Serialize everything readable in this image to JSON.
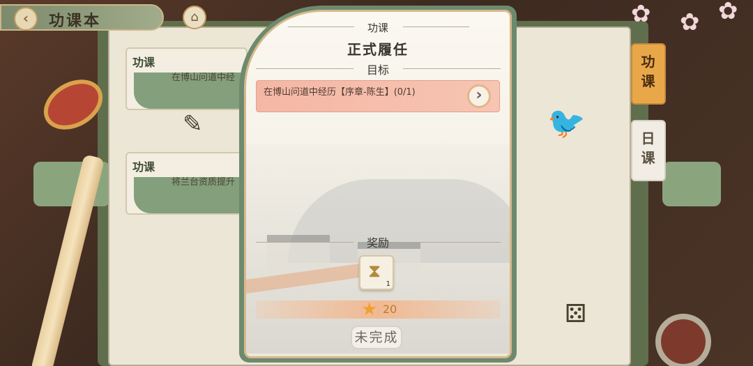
{
  "header": {
    "title": "功课本",
    "back_icon": "back-arrow-icon",
    "home_icon": "home-icon"
  },
  "background_tasks": [
    {
      "tag": "功课",
      "desc": "在博山问道中经"
    },
    {
      "tag": "功课",
      "desc": "将兰台资质提升"
    }
  ],
  "side_tabs": [
    {
      "label": "功课",
      "active": true
    },
    {
      "label": "日课",
      "active": false
    }
  ],
  "modal": {
    "category": "功课",
    "title": "正式履任",
    "goal_section": "目标",
    "goals": [
      {
        "text": "在博山问道中经历【序章-陈生】(0/1)",
        "arrow_icon": "go-arrow-icon"
      }
    ],
    "reward_section": "奖励",
    "reward_items": [
      {
        "icon": "hourglass-icon",
        "count": "1"
      }
    ],
    "star_reward": "20",
    "status_button": "未完成"
  },
  "colors": {
    "accent": "#e8a84a",
    "goal_bg": "#f4b7a5",
    "star": "#f0a030"
  }
}
